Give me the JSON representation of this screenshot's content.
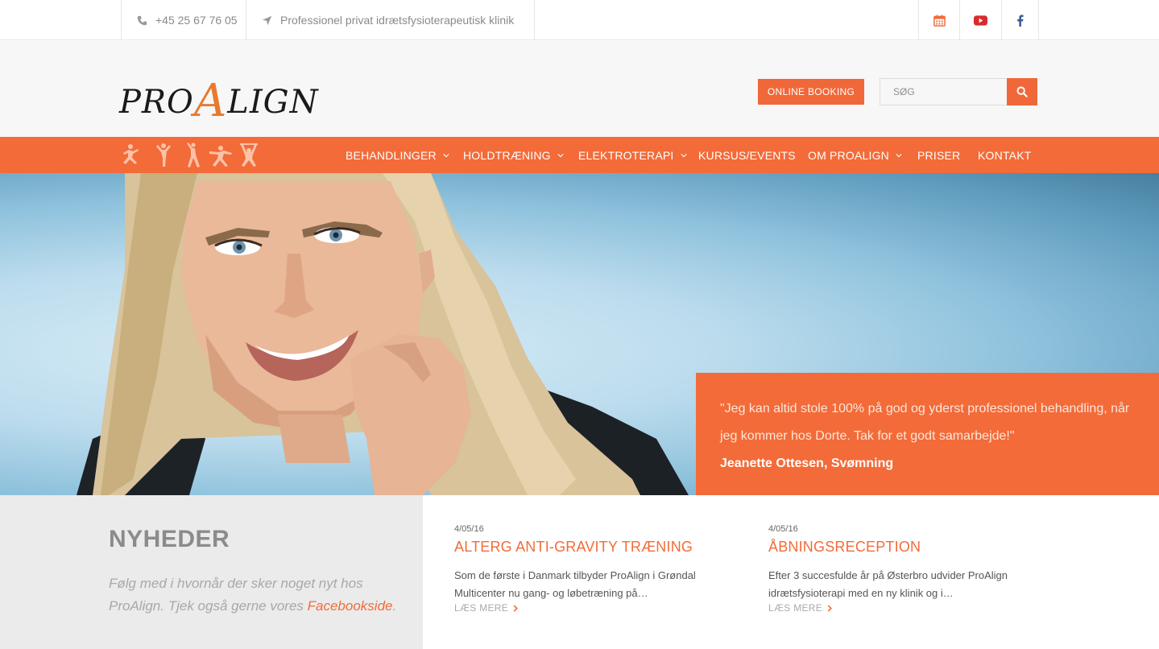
{
  "topbar": {
    "phone": "+45 25 67 76 05",
    "tagline": "Professionel privat idrætsfysioterapeutisk klinik",
    "icons": [
      "phone-icon",
      "location-arrow-icon",
      "calendar-icon",
      "youtube-icon",
      "facebook-icon"
    ]
  },
  "header": {
    "logo_pro": "PRO",
    "logo_a": "A",
    "logo_lign": "LIGN",
    "booking_label": "ONLINE BOOKING",
    "search_placeholder": "SØG"
  },
  "nav": {
    "items": [
      {
        "label": "BEHANDLINGER",
        "has_dropdown": true
      },
      {
        "label": "HOLDTRÆNING",
        "has_dropdown": true
      },
      {
        "label": "ELEKTROTERAPI",
        "has_dropdown": true
      },
      {
        "label": "KURSUS/EVENTS",
        "has_dropdown": false
      },
      {
        "label": "OM PROALIGN",
        "has_dropdown": true
      },
      {
        "label": "PRISER",
        "has_dropdown": false
      },
      {
        "label": "KONTAKT",
        "has_dropdown": false
      }
    ]
  },
  "hero": {
    "quote": "\"Jeg kan altid stole 100% på god og yderst professionel behandling, når jeg kommer hos Dorte. Tak for et godt samarbejde!\"",
    "author": "Jeanette Ottesen, Svømning"
  },
  "news": {
    "title": "NYHEDER",
    "intro": "Følg med i hvornår der sker noget nyt hos ProAlign. Tjek også gerne vores",
    "intro_link": "Facebookside",
    "intro_end": ".",
    "posts": [
      {
        "date": "4/05/16",
        "title": "ALTERG ANTI-GRAVITY TRÆNING",
        "excerpt": "Som de første i Danmark tilbyder ProAlign i Grøndal Multicenter nu gang- og løbetræning på…",
        "more": "LÆS MERE"
      },
      {
        "date": "4/05/16",
        "title": "ÅBNINGSRECEPTION",
        "excerpt": "Efter 3 succesfulde år på Østerbro udvider ProAlign idrætsfysioterapi med en ny klinik og i…",
        "more": "LÆS MERE"
      }
    ]
  },
  "colors": {
    "accent": "#f36b38",
    "logo_accent": "#e87a2e",
    "news_bg": "#ebebeb"
  }
}
